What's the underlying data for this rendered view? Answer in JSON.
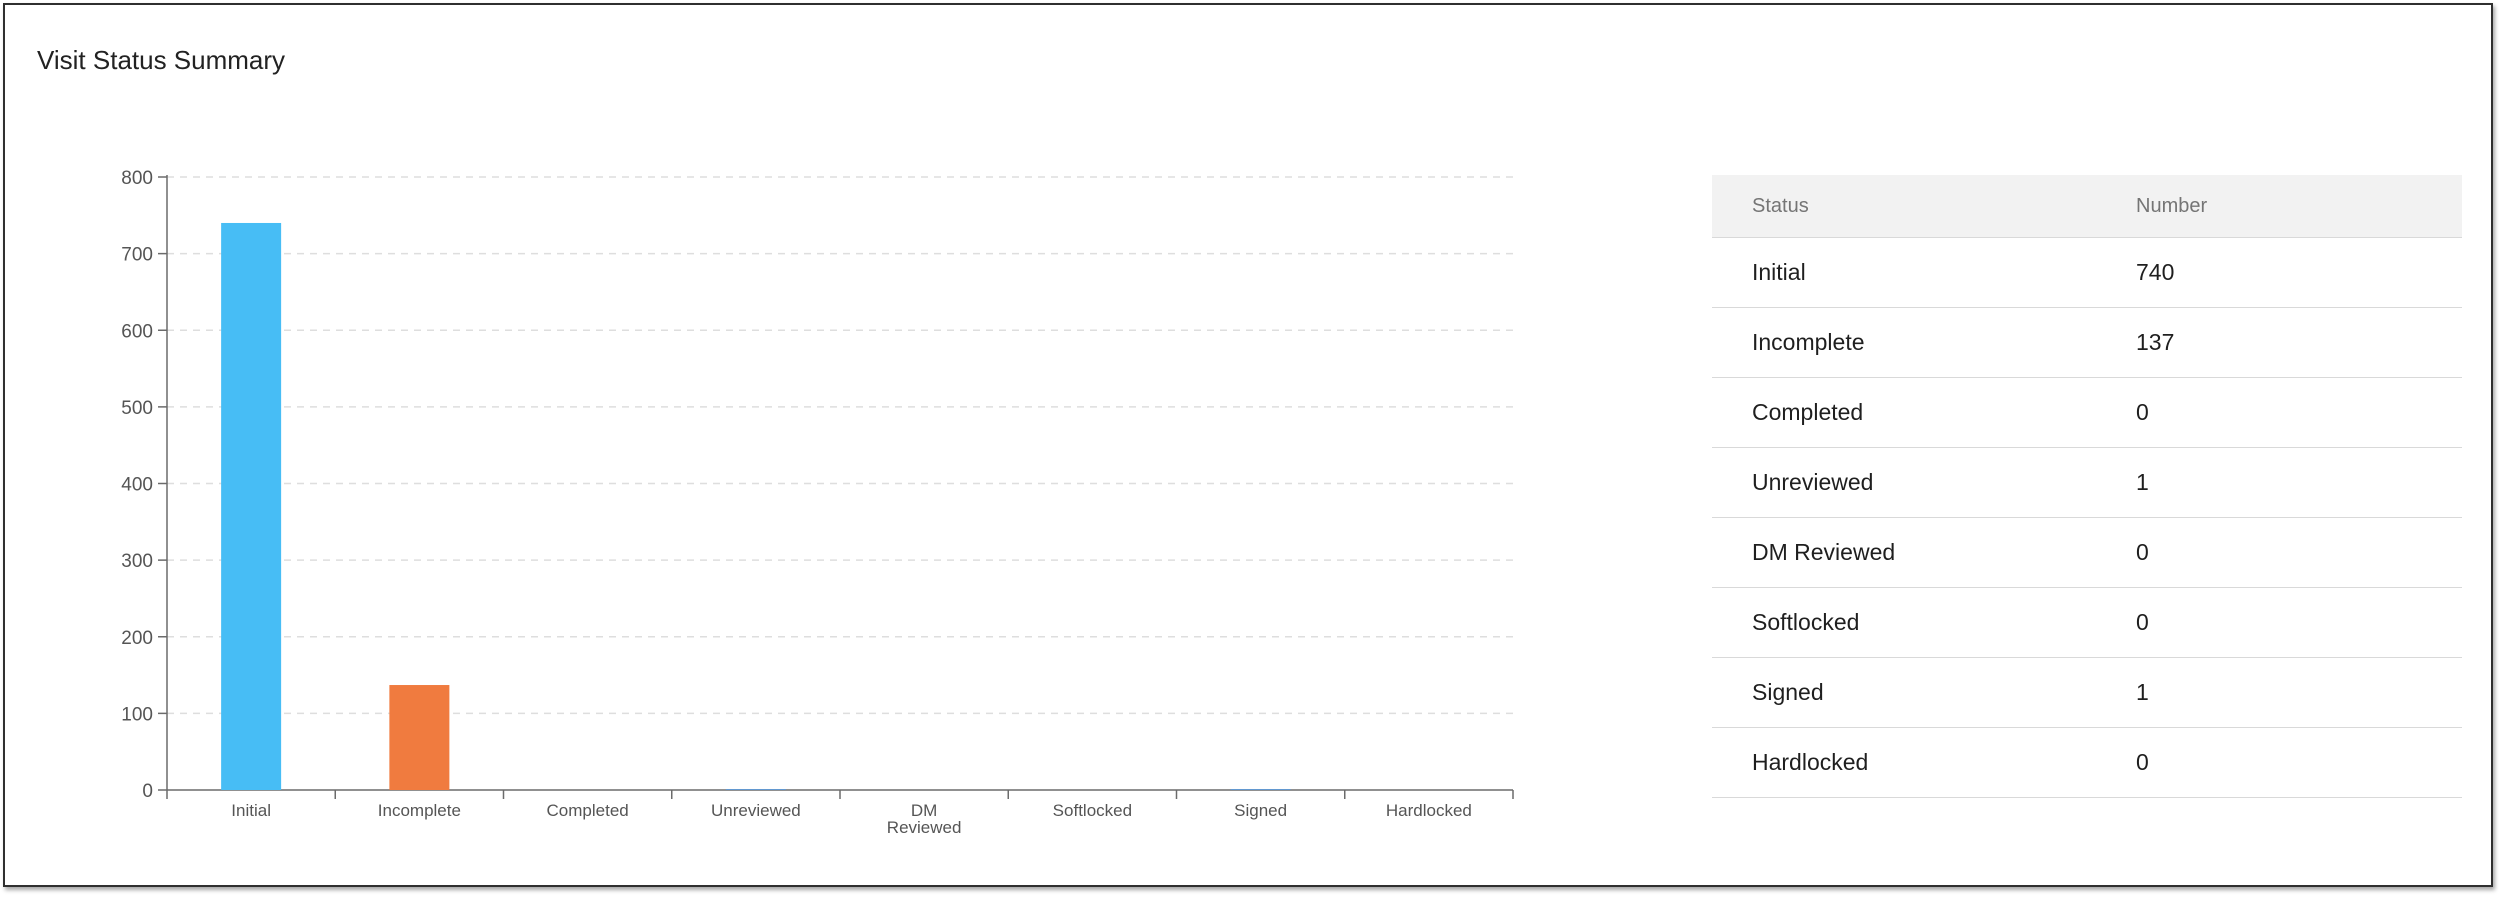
{
  "title": "Visit Status Summary",
  "colors": {
    "initial": "#47bdf5",
    "incomplete": "#f07b3f",
    "other": "#4a90d9"
  },
  "chart_data": {
    "type": "bar",
    "categories": [
      "Initial",
      "Incomplete",
      "Completed",
      "Unreviewed",
      "DM Reviewed",
      "Softlocked",
      "Signed",
      "Hardlocked"
    ],
    "category_lines": [
      [
        "Initial"
      ],
      [
        "Incomplete"
      ],
      [
        "Completed"
      ],
      [
        "Unreviewed"
      ],
      [
        "DM",
        "Reviewed"
      ],
      [
        "Softlocked"
      ],
      [
        "Signed"
      ],
      [
        "Hardlocked"
      ]
    ],
    "values": [
      740,
      137,
      0,
      1,
      0,
      0,
      1,
      0
    ],
    "yticks": [
      "0",
      "100",
      "200",
      "300",
      "400",
      "500",
      "600",
      "700",
      "800"
    ],
    "ylim": [
      0,
      800
    ],
    "grid": true,
    "xlabel": "",
    "ylabel": ""
  },
  "table": {
    "headers": [
      "Status",
      "Number"
    ],
    "rows": [
      [
        "Initial",
        "740"
      ],
      [
        "Incomplete",
        "137"
      ],
      [
        "Completed",
        "0"
      ],
      [
        "Unreviewed",
        "1"
      ],
      [
        "DM Reviewed",
        "0"
      ],
      [
        "Softlocked",
        "0"
      ],
      [
        "Signed",
        "1"
      ],
      [
        "Hardlocked",
        "0"
      ]
    ]
  }
}
